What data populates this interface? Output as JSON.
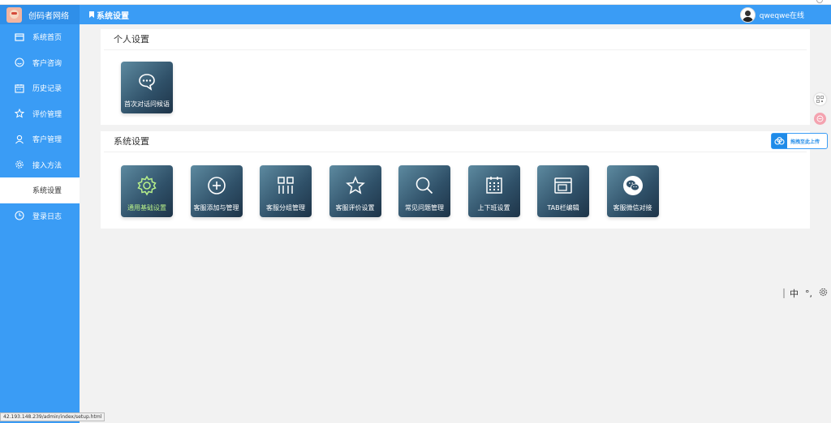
{
  "brand": {
    "name": "创码者网络"
  },
  "header": {
    "title": "系统设置",
    "user": "qweqwe在线"
  },
  "sidebar": {
    "items": [
      {
        "label": "系统首页",
        "icon": "window-icon"
      },
      {
        "label": "客户咨询",
        "icon": "smile-icon"
      },
      {
        "label": "历史记录",
        "icon": "calendar-icon"
      },
      {
        "label": "评价管理",
        "icon": "star-icon"
      },
      {
        "label": "客户管理",
        "icon": "user-icon"
      },
      {
        "label": "接入方法",
        "icon": "gear-icon"
      },
      {
        "label": "系统设置",
        "icon": "",
        "active": true
      },
      {
        "label": "登录日志",
        "icon": "clock-icon"
      }
    ]
  },
  "personal": {
    "title": "个人设置",
    "tiles": [
      {
        "label": "首次对话问候语",
        "icon": "chat-bubble-icon"
      }
    ]
  },
  "system": {
    "title": "系统设置",
    "tiles": [
      {
        "label": "通用基础设置",
        "icon": "gear-icon",
        "active": true
      },
      {
        "label": "客服添加与管理",
        "icon": "plus-circle-icon"
      },
      {
        "label": "客服分组管理",
        "icon": "grid-icon"
      },
      {
        "label": "客服评价设置",
        "icon": "star-icon"
      },
      {
        "label": "常见问题管理",
        "icon": "search-icon"
      },
      {
        "label": "上下班设置",
        "icon": "calendar-icon"
      },
      {
        "label": "TAB栏编辑",
        "icon": "window-icon"
      },
      {
        "label": "客服微信对接",
        "icon": "wechat-icon"
      }
    ]
  },
  "upload_widget": {
    "label": "拖拽至此上传"
  },
  "ime": {
    "lang": "中",
    "punct": "°,"
  },
  "status_url": "42.193.148.239/admin/index/setup.html",
  "colors": {
    "primary": "#3a9cf5",
    "tile_dark": "#1e3448",
    "active_text": "#b8f08a"
  }
}
